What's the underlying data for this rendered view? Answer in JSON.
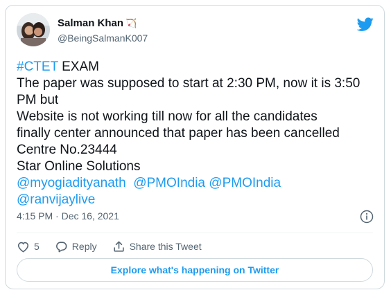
{
  "user": {
    "name": "Salman Khan",
    "name_emoji": "🏹",
    "handle": "@BeingSalmanK007"
  },
  "tweet": {
    "hashtag": "#CTET",
    "hashtag_rest": " EXAM",
    "line2": "The paper was supposed to start at 2:30 PM, now it is 3:50",
    "line3": "PM but",
    "line4": "Website is not working till now for all the candidates",
    "line5": "finally center announced that paper has been cancelled",
    "line6": "Centre No.23444",
    "line7": "Star Online Solutions",
    "mention1": "@myogiadityanath",
    "mention2": "@PMOIndia",
    "mention3": "@PMOIndia",
    "mention4": "@ranvijaylive"
  },
  "meta": {
    "timestamp": "4:15 PM · Dec 16, 2021"
  },
  "actions": {
    "like_count": "5",
    "reply_label": "Reply",
    "share_label": "Share this Tweet"
  },
  "explore_label": "Explore what's happening on Twitter",
  "colors": {
    "accent": "#1d9bf0",
    "text": "#0f1419",
    "muted": "#536471",
    "border": "#cfd9de"
  },
  "icons": [
    "avatar",
    "twitter-logo-icon",
    "bow-emoji-icon",
    "info-icon",
    "heart-icon",
    "reply-icon",
    "share-icon"
  ]
}
